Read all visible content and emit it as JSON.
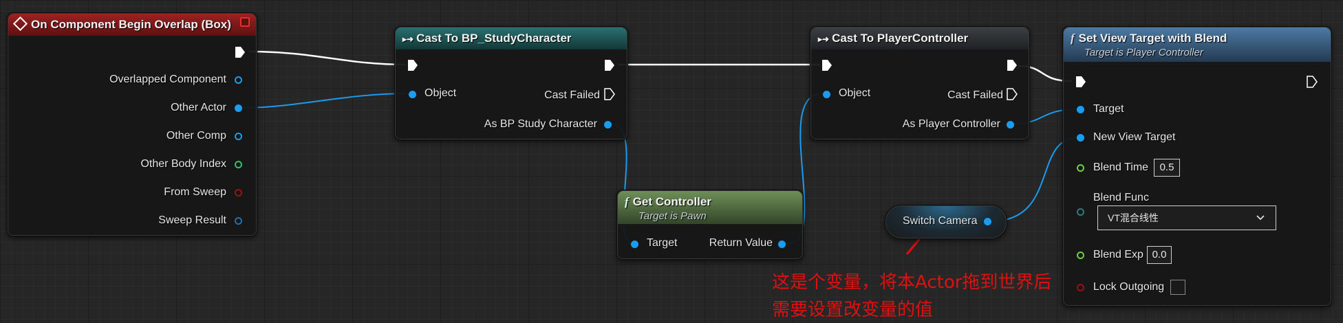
{
  "nodes": {
    "begin_overlap": {
      "title": "On Component Begin Overlap (Box)",
      "pins": [
        "Overlapped Component",
        "Other Actor",
        "Other Comp",
        "Other Body Index",
        "From Sweep",
        "Sweep Result"
      ]
    },
    "cast_study": {
      "title": "Cast To BP_StudyCharacter",
      "object_pin": "Object",
      "cast_failed": "Cast Failed",
      "as_pin": "As BP Study Character"
    },
    "cast_pc": {
      "title": "Cast To PlayerController",
      "object_pin": "Object",
      "cast_failed": "Cast Failed",
      "as_pin": "As Player Controller"
    },
    "get_controller": {
      "title": "Get Controller",
      "subtitle": "Target is Pawn",
      "target_pin": "Target",
      "return_pin": "Return Value"
    },
    "switch_camera": {
      "label": "Switch Camera"
    },
    "set_view_target": {
      "title": "Set View Target with Blend",
      "subtitle": "Target is Player Controller",
      "target_pin": "Target",
      "new_view_target_pin": "New View Target",
      "blend_time_label": "Blend Time",
      "blend_time_value": "0.5",
      "blend_func_label": "Blend Func",
      "blend_func_value": "VT混合线性",
      "blend_exp_label": "Blend Exp",
      "blend_exp_value": "0.0",
      "lock_outgoing_label": "Lock Outgoing"
    }
  },
  "annotation": {
    "line1": "这是个变量，将本Actor拖到世界后",
    "line2": "需要设置改变量的值",
    "color": "#e01010"
  },
  "colors": {
    "exec_wire": "#ffffff",
    "object_wire": "#1a9cf0",
    "event_header": "#8e1c1c",
    "cast_header": "#1d5b5b",
    "function_header": "#3b6a92",
    "pure_header": "#4f6f3a"
  }
}
